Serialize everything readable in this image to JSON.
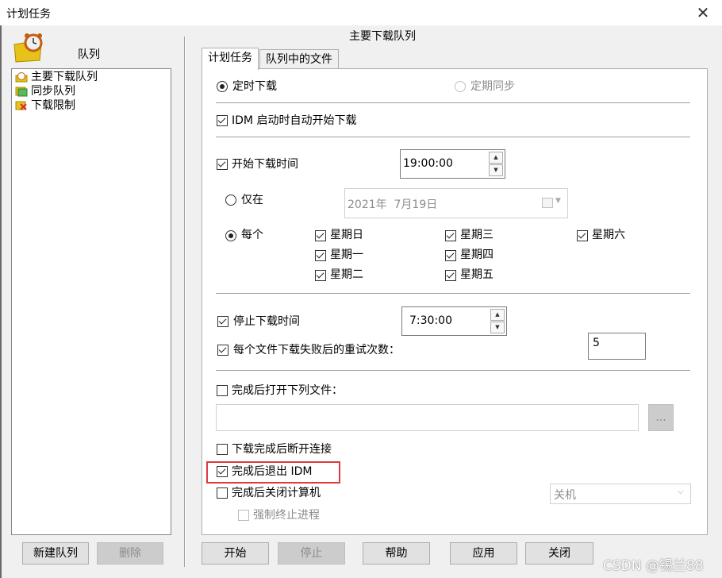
{
  "window": {
    "title": "计划任务",
    "close_glyph": "✕"
  },
  "sidebar": {
    "logo_icon": "alarm-clock-folder-icon",
    "heading": "队列",
    "items": [
      {
        "label": "主要下载队列",
        "icon": "queue-clock-icon",
        "selected": true
      },
      {
        "label": "同步队列",
        "icon": "sync-queue-icon"
      },
      {
        "label": "下载限制",
        "icon": "limit-queue-icon"
      }
    ],
    "new_button": "新建队列",
    "delete_button": "删除"
  },
  "main": {
    "title": "主要下载队列",
    "tabs": [
      {
        "label": "计划任务",
        "active": true
      },
      {
        "label": "队列中的文件",
        "active": false
      }
    ],
    "mode": {
      "one_time_label": "定时下载",
      "periodic_label": "定期同步",
      "selected": "one_time"
    },
    "start_on_idm_startup": {
      "label": "IDM 启动时自动开始下载",
      "checked": true
    },
    "start_time": {
      "label": "开始下载时间",
      "checked": true,
      "value": "19:00:00"
    },
    "once": {
      "label": "仅在",
      "date_value": "2021年  7月19日",
      "selected": false
    },
    "daily": {
      "label": "每个",
      "selected": true,
      "days": [
        {
          "label": "星期日",
          "checked": true
        },
        {
          "label": "星期一",
          "checked": true
        },
        {
          "label": "星期二",
          "checked": true
        },
        {
          "label": "星期三",
          "checked": true
        },
        {
          "label": "星期四",
          "checked": true
        },
        {
          "label": "星期五",
          "checked": true
        },
        {
          "label": "星期六",
          "checked": true
        }
      ]
    },
    "stop_time": {
      "label": "停止下载时间",
      "checked": true,
      "value": "7:30:00"
    },
    "retries": {
      "label": "每个文件下载失败后的重试次数：",
      "checked": true,
      "value": "5"
    },
    "open_file": {
      "label": "完成后打开下列文件：",
      "checked": false,
      "path_value": "",
      "browse_label": "..."
    },
    "hang_up": {
      "label": "下载完成后断开连接",
      "checked": false
    },
    "exit_idm": {
      "label": "完成后退出 IDM",
      "checked": true
    },
    "shutdown": {
      "label": "完成后关闭计算机",
      "checked": false,
      "option": "关机"
    },
    "force_terminate": {
      "label": "强制终止进程",
      "checked": false,
      "disabled": true
    }
  },
  "footer": {
    "start": "开始",
    "stop": "停止",
    "help": "帮助",
    "apply": "应用",
    "close": "关闭"
  },
  "watermark": "CSDN @锡兰88",
  "colors": {
    "highlight_border": "#e0393e",
    "panel_bg": "#ffffff",
    "window_bg": "#f0f0f0"
  }
}
